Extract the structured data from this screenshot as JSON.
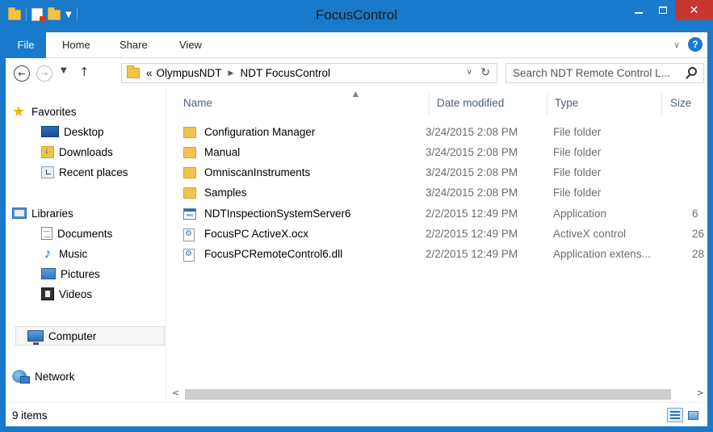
{
  "window": {
    "title": "FocusControl",
    "close_glyph": "✕"
  },
  "ribbon": {
    "tabs": [
      "File",
      "Home",
      "Share",
      "View"
    ],
    "help": "?"
  },
  "address": {
    "overflow": "«",
    "crumbs": [
      "OlympusNDT",
      "NDT FocusControl"
    ],
    "search_placeholder": "Search NDT Remote Control L..."
  },
  "nav": {
    "favorites": "Favorites",
    "favorites_items": [
      "Desktop",
      "Downloads",
      "Recent places"
    ],
    "libraries": "Libraries",
    "libraries_items": [
      "Documents",
      "Music",
      "Pictures",
      "Videos"
    ],
    "computer": "Computer",
    "network": "Network"
  },
  "columns": {
    "name": "Name",
    "date": "Date modified",
    "type": "Type",
    "size": "Size"
  },
  "files": [
    {
      "name": "Configuration Manager",
      "date": "3/24/2015 2:08 PM",
      "type": "File folder",
      "size": "",
      "icon": "folder-icon"
    },
    {
      "name": "Manual",
      "date": "3/24/2015 2:08 PM",
      "type": "File folder",
      "size": "",
      "icon": "folder-icon"
    },
    {
      "name": "OmniscanInstruments",
      "date": "3/24/2015 2:08 PM",
      "type": "File folder",
      "size": "",
      "icon": "folder-icon"
    },
    {
      "name": "Samples",
      "date": "3/24/2015 2:08 PM",
      "type": "File folder",
      "size": "",
      "icon": "folder-icon"
    },
    {
      "name": "NDTInspectionSystemServer6",
      "date": "2/2/2015 12:49 PM",
      "type": "Application",
      "size": "6",
      "icon": "application-icon"
    },
    {
      "name": "FocusPC ActiveX.ocx",
      "date": "2/2/2015 12:49 PM",
      "type": "ActiveX control",
      "size": "26",
      "icon": "ocx-file-icon"
    },
    {
      "name": "FocusPCRemoteControl6.dll",
      "date": "2/2/2015 12:49 PM",
      "type": "Application extens...",
      "size": "28",
      "icon": "dll-file-icon"
    }
  ],
  "status": {
    "items": "9 items"
  },
  "colors": {
    "titlebar": "#1979ca",
    "close": "#c7372d",
    "folder": "#f1c34a"
  }
}
